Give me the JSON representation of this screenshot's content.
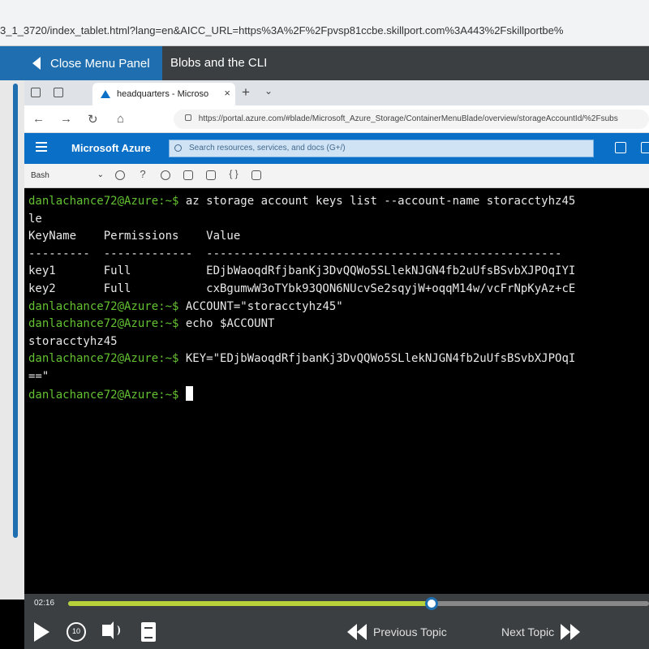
{
  "outer_browser": {
    "url": "3_1_3720/index_tablet.html?lang=en&AICC_URL=https%3A%2F%2Fpvsp81ccbe.skillport.com%3A443%2Fskillportbe%"
  },
  "player_header": {
    "close_menu_label": "Close Menu Panel",
    "course_title": "Blobs and the CLI"
  },
  "inner_browser": {
    "tab_title": "headquarters - Microso",
    "tab_close": "×",
    "new_tab": "+",
    "tab_menu": "⌄",
    "back": "←",
    "forward": "→",
    "refresh": "↻",
    "home": "⌂",
    "url": "https://portal.azure.com/#blade/Microsoft_Azure_Storage/ContainerMenuBlade/overview/storageAccountId/%2Fsubs"
  },
  "azure_portal": {
    "brand": "Microsoft Azure",
    "search_placeholder": "Search resources, services, and docs (G+/)"
  },
  "cloud_shell": {
    "shell_type": "Bash",
    "chevron": "⌄",
    "help": "?"
  },
  "terminal": {
    "prompt": "danlachance72@Azure:~$",
    "lines": [
      {
        "prompt": "danlachance72@Azure:~$",
        "text": " az storage account keys list --account-name storacctyhz45"
      },
      {
        "prompt": "",
        "text": "le"
      },
      {
        "prompt": "",
        "text": "KeyName    Permissions    Value"
      },
      {
        "prompt": "",
        "text": "---------  -------------  ----------------------------------------------------"
      },
      {
        "prompt": "",
        "text": "key1       Full           EDjbWaoqdRfjbanKj3DvQQWo5SLlekNJGN4fb2uUfsBSvbXJPOqIYI"
      },
      {
        "prompt": "",
        "text": "key2       Full           cxBgumwW3oTYbk93QON6NUcvSe2sqyjW+oqqM14w/vcFrNpKyAz+cE"
      },
      {
        "prompt": "danlachance72@Azure:~$",
        "text": " ACCOUNT=\"storacctyhz45\""
      },
      {
        "prompt": "danlachance72@Azure:~$",
        "text": " echo $ACCOUNT"
      },
      {
        "prompt": "",
        "text": "storacctyhz45"
      },
      {
        "prompt": "danlachance72@Azure:~$",
        "text": " KEY=\"EDjbWaoqdRfjbanKj3DvQQWo5SLlekNJGN4fb2uUfsBSvbXJPOqI"
      },
      {
        "prompt": "",
        "text": "==\""
      },
      {
        "prompt": "danlachance72@Azure:~$",
        "text": " ",
        "cursor": true
      }
    ]
  },
  "player_controls": {
    "elapsed_time": "02:16",
    "progress": 0.625,
    "replay_seconds": "10",
    "previous_label": "Previous Topic",
    "next_label": "Next Topic"
  },
  "colors": {
    "accent_blue": "#1f6fb0",
    "azure_blue": "#0a6fc6",
    "progress_green": "#b7d23b",
    "prompt_green": "#63c132",
    "player_dark": "#3b3f42"
  }
}
